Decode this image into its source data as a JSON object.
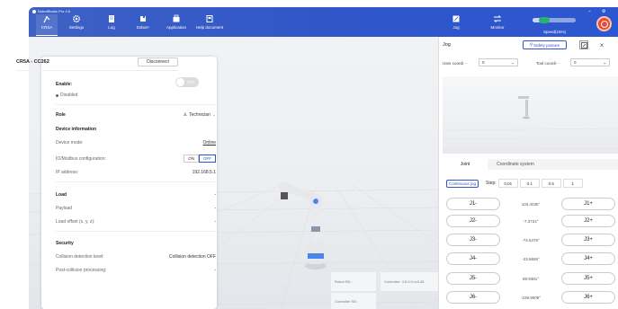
{
  "app": {
    "title": "DobotStudio Pro 4.5"
  },
  "toolbar": {
    "items": [
      {
        "label": "CRSA",
        "icon": "robot-arm-icon"
      },
      {
        "label": "Settings",
        "icon": "gear-icon"
      },
      {
        "label": "Log",
        "icon": "log-icon"
      },
      {
        "label": "Dobot+",
        "icon": "plugin-icon"
      },
      {
        "label": "Application",
        "icon": "application-icon"
      },
      {
        "label": "Help document",
        "icon": "help-document-icon"
      }
    ],
    "right": [
      {
        "label": "Jog",
        "icon": "jog-icon"
      },
      {
        "label": "Monitor",
        "icon": "monitor-icon"
      }
    ],
    "speed_label": "Speed(15%)",
    "speed_value": 15
  },
  "panel": {
    "title": "CR5A - CC262",
    "disconnect": "Disconnect",
    "enable_label": "Enable:",
    "enable_toggle": "OFF",
    "status": "Disabled",
    "role_label": "Role",
    "role_value": "Technician",
    "device_info": "Device information",
    "device_mode_label": "Device mode:",
    "device_mode_value": "Online",
    "io_label": "IO/Modbus configuration:",
    "io_on": "ON",
    "io_off": "OFF",
    "ip_label": "IP address:",
    "ip_value": "192.168.5.1",
    "load_heading": "Load",
    "load_heading_value": "-",
    "payload_label": "Payload",
    "payload_value": "-",
    "load_offset_label": "Load offset (x, y, z):",
    "load_offset_value": "-",
    "security_heading": "Security",
    "collision_label": "Collision detection level:",
    "collision_value": "Collision detection OFF",
    "post_collision_label": "Post-collision processing:",
    "post_collision_value": "-"
  },
  "scene_info": {
    "robot_sn": "Robot SN :",
    "controller": "Controller: 4.5.0.0-rc3-46",
    "controller_sn": "Controller SN :"
  },
  "jog": {
    "title": "Jog",
    "safety": "Safety posture",
    "user_coord_label": "User coordi···",
    "user_coord_value": "0",
    "tool_coord_label": "Tool coordi···",
    "tool_coord_value": "0",
    "tabs": [
      "Joint",
      "Coordinate system"
    ],
    "continuous": "Continuous jog",
    "step_label": "Step:",
    "steps": [
      "0.01",
      "0.1",
      "0.5",
      "1"
    ],
    "joints": [
      {
        "minus": "J1-",
        "value": "103.4035°",
        "plus": "J1+"
      },
      {
        "minus": "J2-",
        "value": "-7.3724°",
        "plus": "J2+"
      },
      {
        "minus": "J3-",
        "value": "-74.5476°",
        "plus": "J3+"
      },
      {
        "minus": "J4-",
        "value": "-23.6655°",
        "plus": "J4+"
      },
      {
        "minus": "J5-",
        "value": "89.9381°",
        "plus": "J5+"
      },
      {
        "minus": "J6-",
        "value": "-109.9009°",
        "plus": "J6+"
      }
    ]
  }
}
